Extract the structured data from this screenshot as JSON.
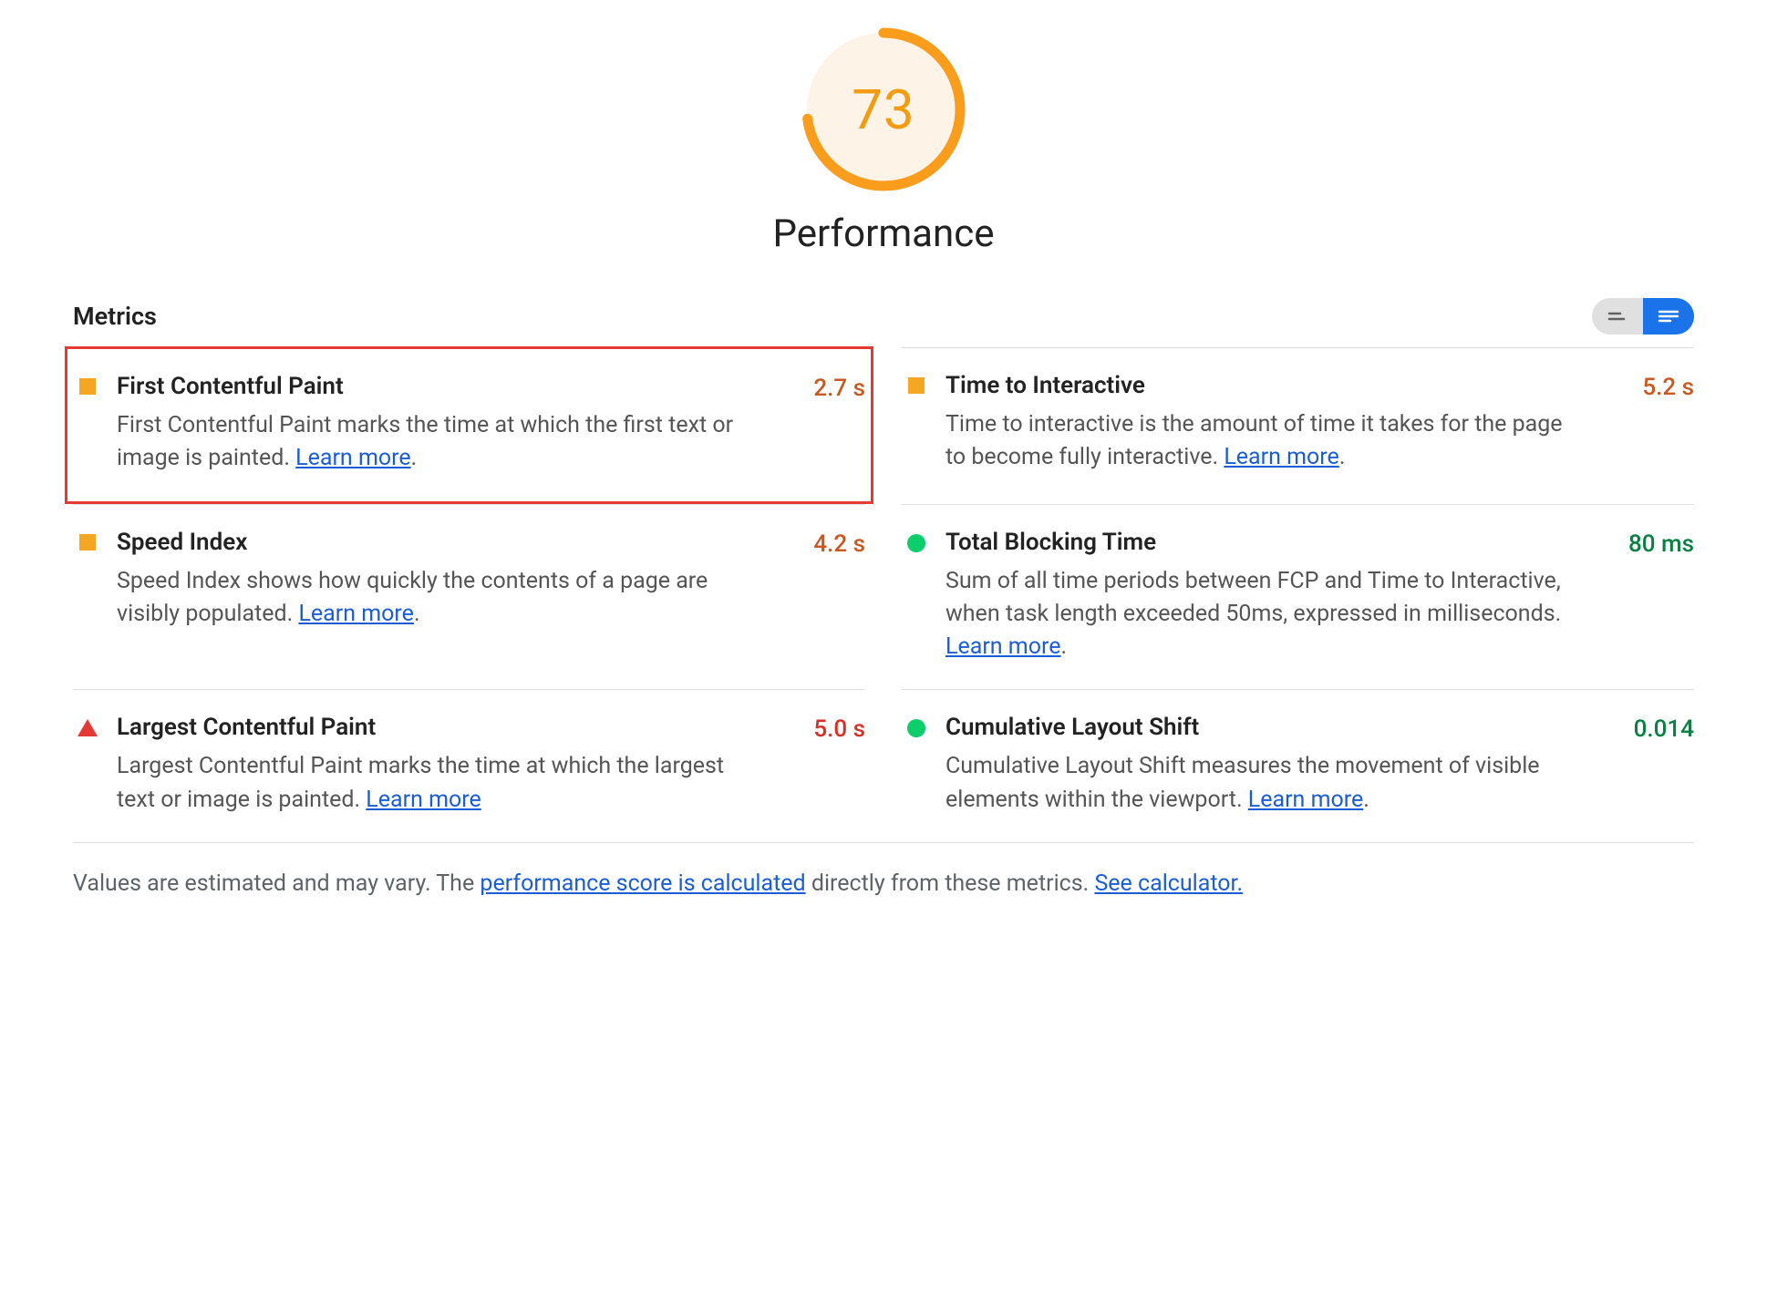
{
  "gauge": {
    "score": "73",
    "score_num": 73,
    "title": "Performance",
    "color": "#fa9d1c"
  },
  "header": {
    "title": "Metrics"
  },
  "metrics": [
    {
      "id": "fcp",
      "name": "First Contentful Paint",
      "desc_prefix": "First Contentful Paint marks the time at which the first text or image is painted. ",
      "learn": "Learn more",
      "desc_suffix": ".",
      "value": "2.7 s",
      "status": "average",
      "icon": "square",
      "value_class": "val-orange",
      "highlight": true
    },
    {
      "id": "tti",
      "name": "Time to Interactive",
      "desc_prefix": "Time to interactive is the amount of time it takes for the page to become fully interactive. ",
      "learn": "Learn more",
      "desc_suffix": ".",
      "value": "5.2 s",
      "status": "average",
      "icon": "square",
      "value_class": "val-orange",
      "highlight": false
    },
    {
      "id": "si",
      "name": "Speed Index",
      "desc_prefix": "Speed Index shows how quickly the contents of a page are visibly populated. ",
      "learn": "Learn more",
      "desc_suffix": ".",
      "value": "4.2 s",
      "status": "average",
      "icon": "square",
      "value_class": "val-orange",
      "highlight": false
    },
    {
      "id": "tbt",
      "name": "Total Blocking Time",
      "desc_prefix": "Sum of all time periods between FCP and Time to Interactive, when task length exceeded 50ms, expressed in milliseconds. ",
      "learn": "Learn more",
      "desc_suffix": ".",
      "value": "80 ms",
      "status": "good",
      "icon": "circle",
      "value_class": "val-green",
      "highlight": false
    },
    {
      "id": "lcp",
      "name": "Largest Contentful Paint",
      "desc_prefix": "Largest Contentful Paint marks the time at which the largest text or image is painted. ",
      "learn": "Learn more",
      "desc_suffix": "",
      "value": "5.0 s",
      "status": "poor",
      "icon": "triangle",
      "value_class": "val-red",
      "highlight": false
    },
    {
      "id": "cls",
      "name": "Cumulative Layout Shift",
      "desc_prefix": "Cumulative Layout Shift measures the movement of visible elements within the viewport. ",
      "learn": "Learn more",
      "desc_suffix": ".",
      "value": "0.014",
      "status": "good",
      "icon": "circle",
      "value_class": "val-green",
      "highlight": false
    }
  ],
  "footnote": {
    "pre": "Values are estimated and may vary. The ",
    "link1": "performance score is calculated",
    "mid": " directly from these metrics. ",
    "link2": "See calculator."
  }
}
